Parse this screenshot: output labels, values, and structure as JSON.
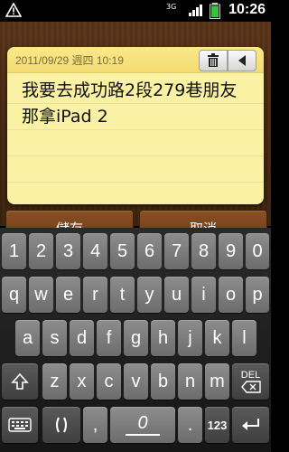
{
  "status": {
    "time": "10:26",
    "network": "3G",
    "icons": [
      "warning-icon",
      "signal-icon",
      "battery-icon"
    ]
  },
  "note": {
    "date": "2011/09/29 週四 10:19",
    "body": "我要去成功路2段279巷朋友那拿iPad 2",
    "paper_color": "#fbf1a5"
  },
  "actions": {
    "save": "儲存",
    "cancel": "取消"
  },
  "keyboard": {
    "row1": [
      "1",
      "2",
      "3",
      "4",
      "5",
      "6",
      "7",
      "8",
      "9",
      "0"
    ],
    "row2": [
      "q",
      "w",
      "e",
      "r",
      "t",
      "y",
      "u",
      "i",
      "o",
      "p"
    ],
    "row3": [
      "a",
      "s",
      "d",
      "f",
      "g",
      "h",
      "j",
      "k",
      "l"
    ],
    "row4": [
      "z",
      "x",
      "c",
      "v",
      "b",
      "n",
      "m"
    ],
    "del_label": "DEL",
    "symbols_label": "123",
    "comma": ",",
    "period": ".",
    "space_label": "0"
  }
}
